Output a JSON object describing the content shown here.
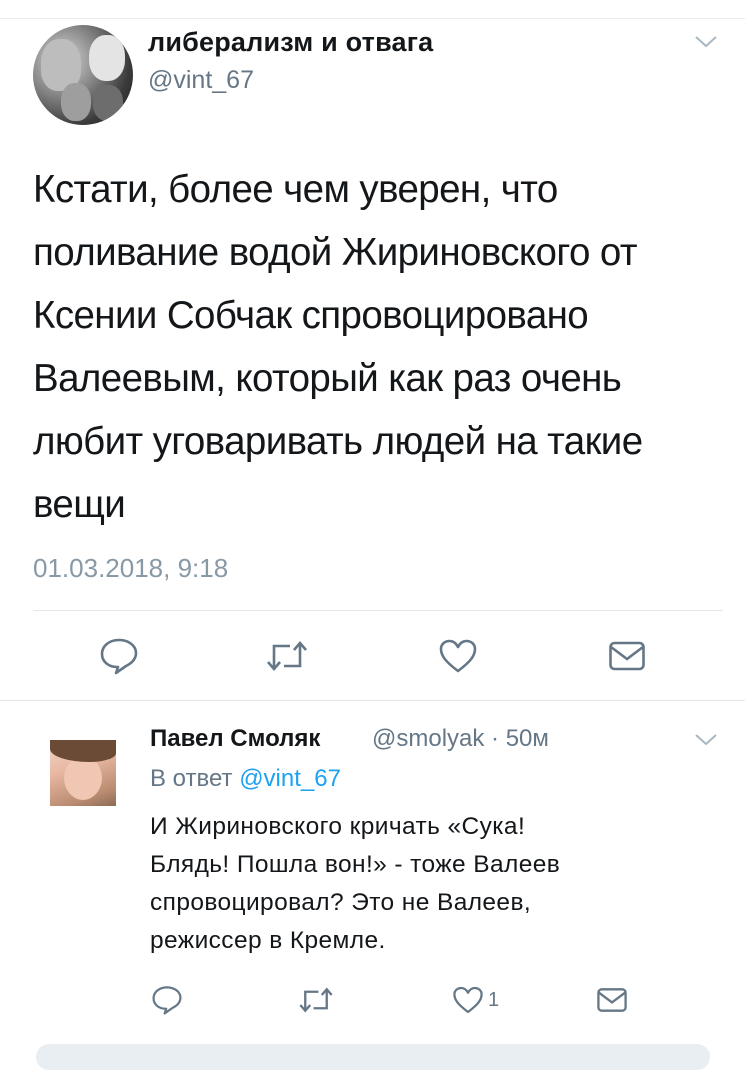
{
  "main_tweet": {
    "display_name": "либерализм и отвага",
    "handle": "@vint_67",
    "text": "Кстати, более чем уверен, что\nполивание водой Жириновского от\nКсении Собчак спровоцировано\nВалеевым, который как раз очень\nлюбит уговаривать людей на такие\nвещи",
    "date": "01.03.2018, 9:18",
    "avatar_icon": "avatar-collage-photo",
    "actions": [
      "reply-icon",
      "retweet-icon",
      "like-icon",
      "message-icon"
    ]
  },
  "reply": {
    "display_name": "Павел Смоляк",
    "meta": "@smolyak · 50м",
    "reply_prefix": "В ответ",
    "reply_to": "@vint_67",
    "text": "И Жириновского кричать «Сука!\nБлядь! Пошла вон!» - тоже Валеев\nспровоцировал? Это не Валеев,\nрежиссер в Кремле.",
    "like_count": "1",
    "avatar_icon": "avatar-photo"
  },
  "colors": {
    "text": "#14171a",
    "secondary": "#657786",
    "date": "#8899a6",
    "link": "#1da1f2",
    "icon": "#657786",
    "divider": "#e1e8ed"
  }
}
